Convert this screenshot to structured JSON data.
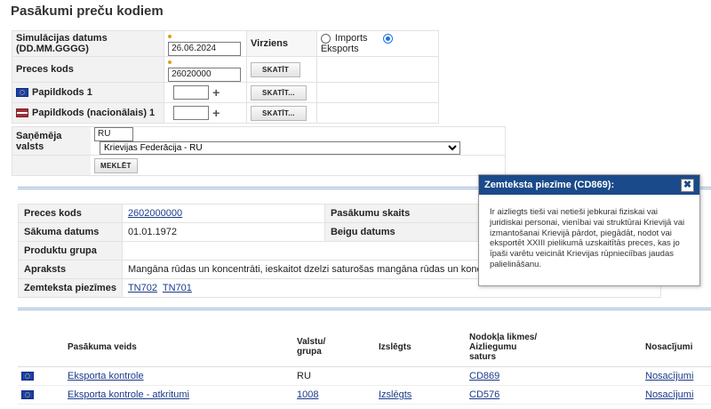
{
  "page": {
    "title": "Pasākumi preču kodiem"
  },
  "form": {
    "date_label": "Simulācijas datums (DD.MM.GGGG)",
    "date_value": "26.06.2024",
    "direction_label": "Virziens",
    "import_label": "Imports",
    "export_label": "Eksports",
    "selected_direction": "Eksports",
    "goods_code_label": "Preces kods",
    "goods_code_value": "26020000",
    "view_button": "SKATĪT",
    "view_button_dots": "SKATĪT...",
    "addcode1_label": "Papildkods 1",
    "addcode_national_label": "Papildkods (nacionālais) 1",
    "plus_symbol": "+"
  },
  "country": {
    "label": "Saņēmēja valsts",
    "code": "RU",
    "name": "Krievijas Federācija - RU",
    "search_button": "MEKLĒT"
  },
  "info": {
    "goods_code_label": "Preces kods",
    "goods_code_value": "2602000000",
    "measures_count_label": "Pasākumu skaits",
    "start_date_label": "Sākuma datums",
    "start_date_value": "01.01.1972",
    "end_date_label": "Beigu datums",
    "product_group_label": "Produktu grupa",
    "description_label": "Apraksts",
    "description_value": "Mangāna rūdas un koncentrāti, ieskaitot dzelzi saturošas mangāna rūdas un koncentrāti, kas sa",
    "footnotes_label": "Zemteksta piezīmes",
    "footnotes": [
      "TN702",
      "TN701"
    ]
  },
  "popup": {
    "title": "Zemteksta piezīme (CD869):",
    "close": "✖",
    "body": "Ir aizliegts tieši vai netieši jebkurai fiziskai vai juridiskai personai, vienībai vai struktūrai Krievijā vai izmantošanai Krievijā pārdot, piegādāt, nodot vai eksportēt XXIII pielikumā uzskaitītās preces, kas jo īpaši varētu veicināt Krievijas rūpnieciības jaudas palielināšanu."
  },
  "results": {
    "headers": {
      "measure_type": "Pasākuma veids",
      "country_line1": "Valstu/",
      "country_line2": "grupa",
      "excluded": "Izslēgts",
      "duty_line1": "Nodokļa likmes/",
      "duty_line2": "Aizliegumu",
      "duty_line3": "saturs",
      "conditions": "Nosacījumi"
    },
    "rows": [
      {
        "type": "Eksporta kontrole",
        "country": "RU",
        "excluded": "",
        "duty": "CD869",
        "conditions": "Nosacījumi"
      },
      {
        "type": "Eksporta kontrole - atkritumi",
        "country": "1008",
        "excluded": "Izslēgts",
        "duty": "CD576",
        "conditions": "Nosacījumi"
      }
    ]
  }
}
